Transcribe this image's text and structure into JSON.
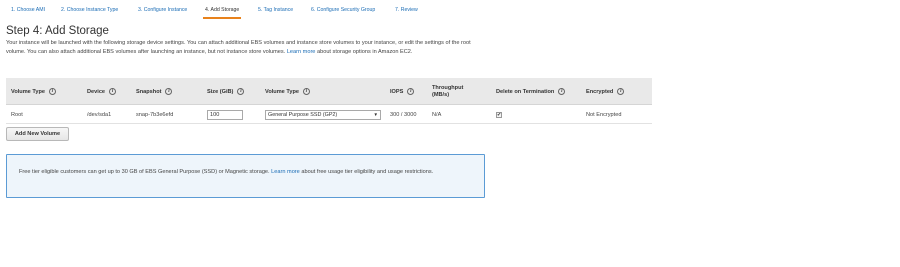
{
  "wizard_tabs": [
    {
      "label": "1. Choose AMI"
    },
    {
      "label": "2. Choose Instance Type"
    },
    {
      "label": "3. Configure Instance"
    },
    {
      "label": "4. Add Storage"
    },
    {
      "label": "5. Tag Instance"
    },
    {
      "label": "6. Configure Security Group"
    },
    {
      "label": "7. Review"
    }
  ],
  "page": {
    "title": "Step 4: Add Storage",
    "description_text": "Your instance will be launched with the following storage device settings. You can attach additional EBS volumes and instance store volumes to your instance, or edit the settings of the root volume. You can also attach additional EBS volumes after launching an instance, but not instance store volumes.",
    "learn_more": "Learn more",
    "description_suffix": "about storage options in Amazon EC2."
  },
  "table": {
    "headers": {
      "volume_type": "Volume Type",
      "device": "Device",
      "snapshot": "Snapshot",
      "size": "Size (GiB)",
      "ebs_volume_type": "Volume Type",
      "iops": "IOPS",
      "throughput": "Throughput (MB/s)",
      "delete_on_termination": "Delete on Termination",
      "encrypted": "Encrypted"
    },
    "info_glyph": "i",
    "row": {
      "volume_type": "Root",
      "device": "/dev/sda1",
      "snapshot": "snap-7b3e6efd",
      "size": "100",
      "ebs_volume_type": "General Purpose SSD (GP2)",
      "iops": "300 / 3000",
      "throughput": "N/A",
      "delete_on_termination_glyph": "✔",
      "encrypted": "Not Encrypted"
    }
  },
  "add_volume_button": "Add New Volume",
  "free_tier": {
    "text": "Free tier eligible customers can get up to 30 GB of EBS General Purpose (SSD) or Magnetic storage.",
    "learn_more": "Learn more",
    "suffix": "about free usage tier eligibility and usage restrictions."
  },
  "colors": {
    "link": "#1a6cb5",
    "active_tab_underline": "#e8821c",
    "info_box_border": "#5b9bd5",
    "header_background": "#e9e9e9"
  }
}
